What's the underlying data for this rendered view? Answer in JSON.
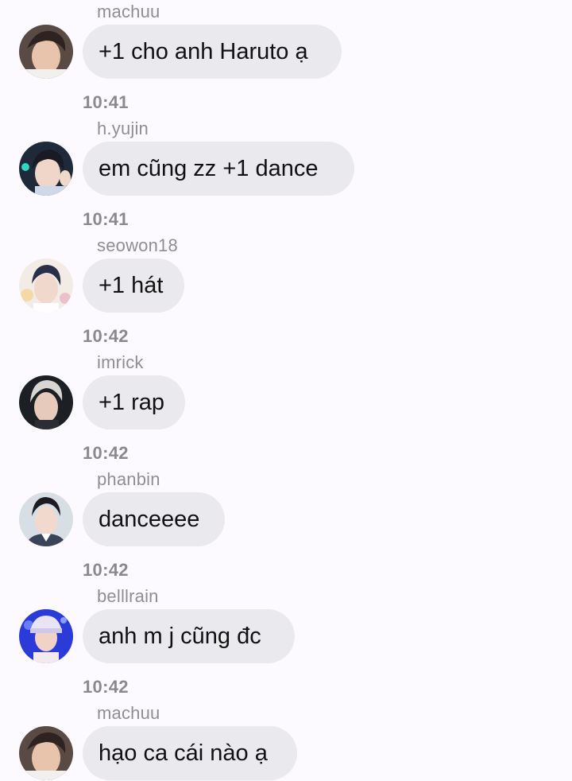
{
  "messages": [
    {
      "user": "machuu",
      "text": "+1 cho anh Haruto ạ",
      "time": "",
      "avatar": "avatar-machuu"
    },
    {
      "user": "h.yujin",
      "text": "em cũng zz +1 dance",
      "time": "10:41",
      "avatar": "avatar-hyujin"
    },
    {
      "user": "seowon18",
      "text": "+1 hát",
      "time": "10:41",
      "avatar": "avatar-seowon18"
    },
    {
      "user": "imrick",
      "text": "+1 rap",
      "time": "10:42",
      "avatar": "avatar-imrick"
    },
    {
      "user": "phanbin",
      "text": "danceeee",
      "time": "10:42",
      "avatar": "avatar-phanbin"
    },
    {
      "user": "belllrain",
      "text": "anh m j cũng đc",
      "time": "10:42",
      "avatar": "avatar-belllrain"
    },
    {
      "user": "machuu",
      "text": "hạo ca cái nào ạ",
      "time": "10:42",
      "avatar": "avatar-machuu"
    }
  ],
  "timestamps": [
    "10:41",
    "10:41",
    "10:42",
    "10:42",
    "10:42",
    "10:42"
  ],
  "colors": {
    "background": "#fdfaff",
    "bubble": "#e9e9ee",
    "username": "#8e8e93",
    "timestamp": "#8a8a8e"
  }
}
